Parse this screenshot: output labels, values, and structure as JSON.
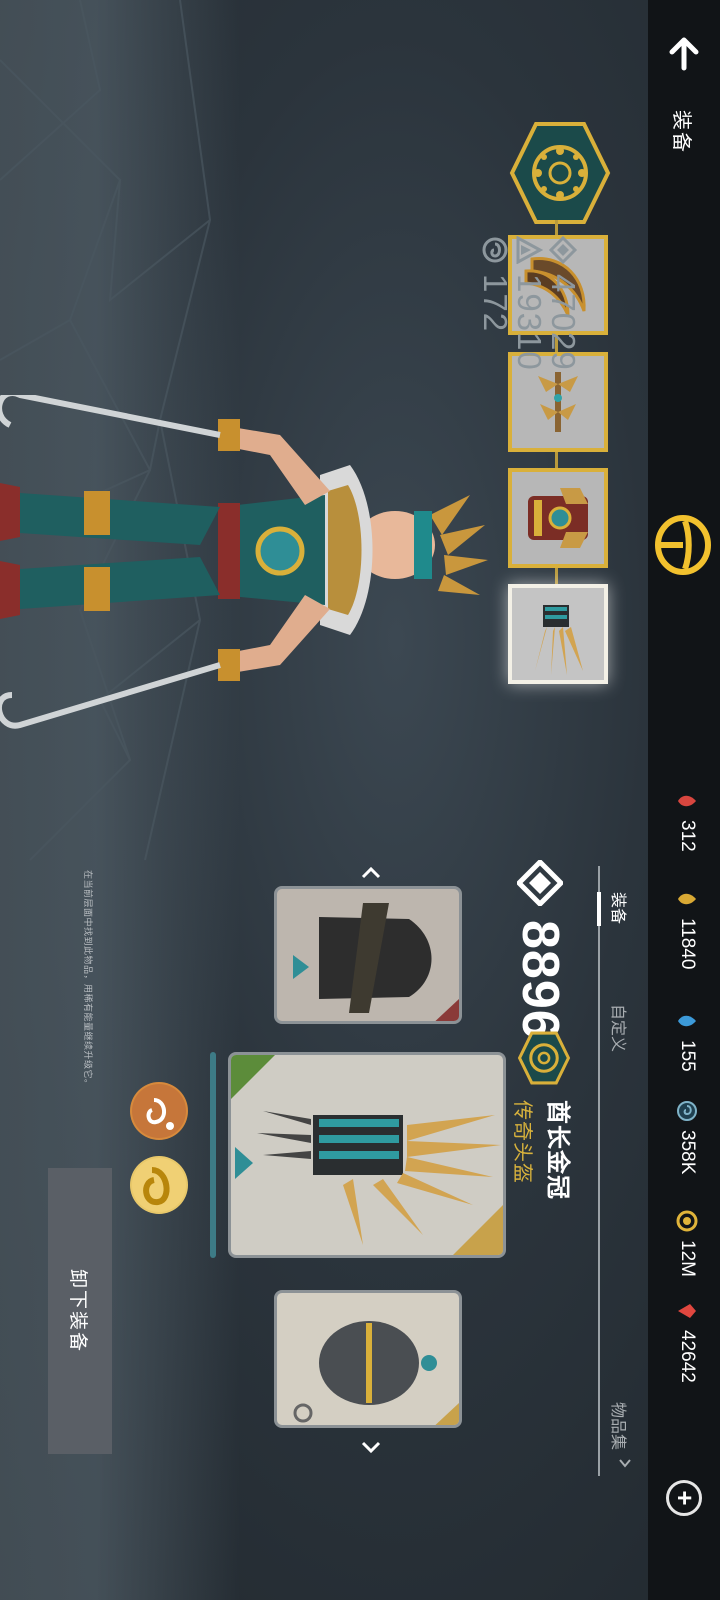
{
  "screen": {
    "title": "装备"
  },
  "currencies": [
    {
      "icon": "red-leaf-icon",
      "value": "312",
      "color": "#d8463f"
    },
    {
      "icon": "gold-leaf-icon",
      "value": "11840",
      "color": "#d9a934"
    },
    {
      "icon": "blue-leaf-icon",
      "value": "155",
      "color": "#3c9ad9"
    },
    {
      "icon": "swirl-coin-icon",
      "value": "358K",
      "color": "#7fb3c8"
    },
    {
      "icon": "gold-coin-icon",
      "value": "12M",
      "color": "#e0b43a"
    },
    {
      "icon": "ruby-icon",
      "value": "42642",
      "color": "#e0473f"
    }
  ],
  "stats": [
    {
      "icon": "power-diamond-icon",
      "value": "47029"
    },
    {
      "icon": "triangle-stat-icon",
      "value": "19310"
    },
    {
      "icon": "swirl-stat-icon",
      "value": "172"
    }
  ],
  "slots": [
    {
      "name": "slot-weapon-sickles",
      "icon": "sickle-weapon-icon",
      "selected": false
    },
    {
      "name": "slot-double-axe",
      "icon": "double-axe-icon",
      "selected": false
    },
    {
      "name": "slot-armor",
      "icon": "armor-icon",
      "selected": false
    },
    {
      "name": "slot-headgear",
      "icon": "feather-crown-icon",
      "selected": true
    }
  ],
  "tabs": {
    "equipment": "装备",
    "customize": "自定义",
    "collection": "物品集"
  },
  "item": {
    "power": "8896",
    "name": "酋长金冠",
    "rarity": "传奇头盔"
  },
  "hint": "在当前层面中找到此物品，用稀有能量继续升级它。",
  "unequip_label": "卸下装备",
  "colors": {
    "accent_gold": "#d9b03a",
    "rarity_gold": "#d8b23c",
    "teal": "#2f8e96"
  }
}
